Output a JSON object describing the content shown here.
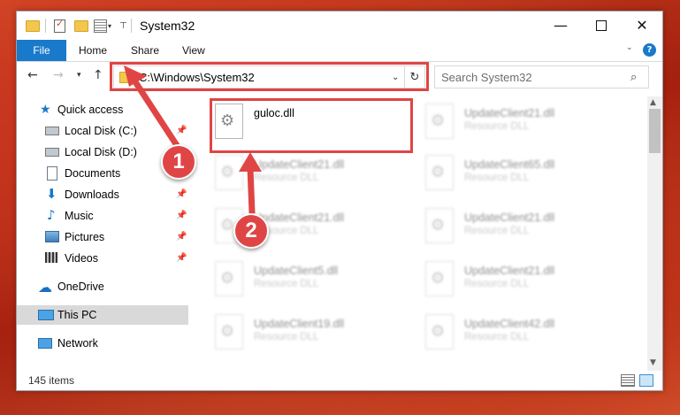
{
  "window": {
    "title": "System32"
  },
  "ribbon": {
    "file_tab": "File",
    "tabs": [
      "Home",
      "Share",
      "View"
    ]
  },
  "address_bar": {
    "path": "C:\\Windows\\System32"
  },
  "search": {
    "placeholder": "Search System32"
  },
  "sidebar": {
    "items": [
      {
        "label": "Quick access",
        "icon": "star-icon",
        "pinned": false
      },
      {
        "label": "Local Disk (C:)",
        "icon": "drive-icon",
        "pinned": true
      },
      {
        "label": "Local Disk (D:)",
        "icon": "drive-icon",
        "pinned": false
      },
      {
        "label": "Documents",
        "icon": "documents-icon",
        "pinned": true
      },
      {
        "label": "Downloads",
        "icon": "downloads-icon",
        "pinned": true
      },
      {
        "label": "Music",
        "icon": "music-icon",
        "pinned": true
      },
      {
        "label": "Pictures",
        "icon": "pictures-icon",
        "pinned": true
      },
      {
        "label": "Videos",
        "icon": "videos-icon",
        "pinned": true
      },
      {
        "label": "OneDrive",
        "icon": "cloud-icon",
        "pinned": false
      },
      {
        "label": "This PC",
        "icon": "computer-icon",
        "pinned": false,
        "selected": true
      },
      {
        "label": "Network",
        "icon": "network-icon",
        "pinned": false
      }
    ]
  },
  "files": [
    {
      "name": "guloc.dll",
      "type": ""
    },
    {
      "name": "UpdateClient21.dll",
      "type": "Resource DLL"
    },
    {
      "name": "UpdateClient21.dll",
      "type": "Resource DLL"
    },
    {
      "name": "UpdateClient65.dll",
      "type": "Resource DLL"
    },
    {
      "name": "UpdateClient21.dll",
      "type": "Resource DLL"
    },
    {
      "name": "UpdateClient21.dll",
      "type": "Resource DLL"
    },
    {
      "name": "UpdateClient5.dll",
      "type": "Resource DLL"
    },
    {
      "name": "UpdateClient21.dll",
      "type": "Resource DLL"
    },
    {
      "name": "UpdateClient19.dll",
      "type": "Resource DLL"
    },
    {
      "name": "UpdateClient42.dll",
      "type": "Resource DLL"
    }
  ],
  "status_bar": {
    "item_count": "145 items"
  },
  "annotations": {
    "step1": "1",
    "step2": "2"
  },
  "colors": {
    "accent": "#1979ca",
    "highlight": "#e04545"
  }
}
